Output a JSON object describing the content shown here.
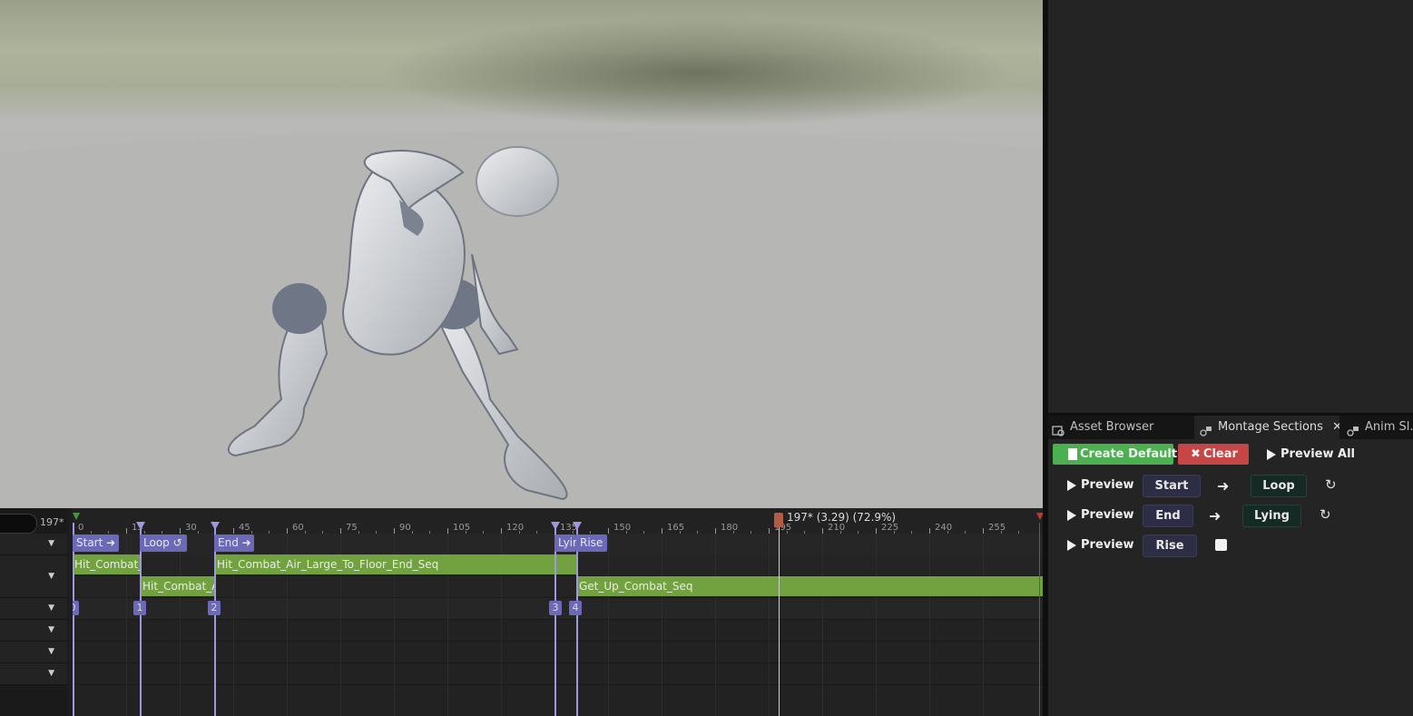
{
  "timeline": {
    "frame_readout": "197*",
    "playhead_label": "197* (3.29) (72.9%)",
    "ticks": [
      "0",
      "15",
      "30",
      "45",
      "60",
      "75",
      "90",
      "105",
      "120",
      "135",
      "150",
      "165",
      "180",
      "195",
      "210",
      "225",
      "240",
      "255"
    ],
    "sections": [
      "Start",
      "Loop",
      "End",
      "Lyir",
      "Rise"
    ],
    "segments_row1": [
      "Hit_Combat_",
      "Hit_Combat_Air_Large_To_Floor_End_Seq"
    ],
    "segments_row2": [
      "Hit_Combat_A",
      "Get_Up_Combat_Seq"
    ],
    "notifies": [
      "0",
      "1",
      "2",
      "3",
      "4"
    ]
  },
  "tabs": {
    "asset_browser": "Asset Browser",
    "montage_sections": "Montage Sections",
    "anim_slot": "Anim Sl...M"
  },
  "sections_panel": {
    "create_default": "Create Default",
    "clear": "Clear",
    "preview_all": "Preview All",
    "rows": [
      {
        "preview": "Preview",
        "from": "Start",
        "to": "Loop"
      },
      {
        "preview": "Preview",
        "from": "End",
        "to": "Lying"
      },
      {
        "preview": "Preview",
        "from": "Rise"
      }
    ]
  },
  "colors": {
    "segment_green": "#72a23f",
    "section_purple": "#6c69b8",
    "create_green": "#4caf50",
    "clear_red": "#c64545",
    "playhead": "#b25c46"
  }
}
